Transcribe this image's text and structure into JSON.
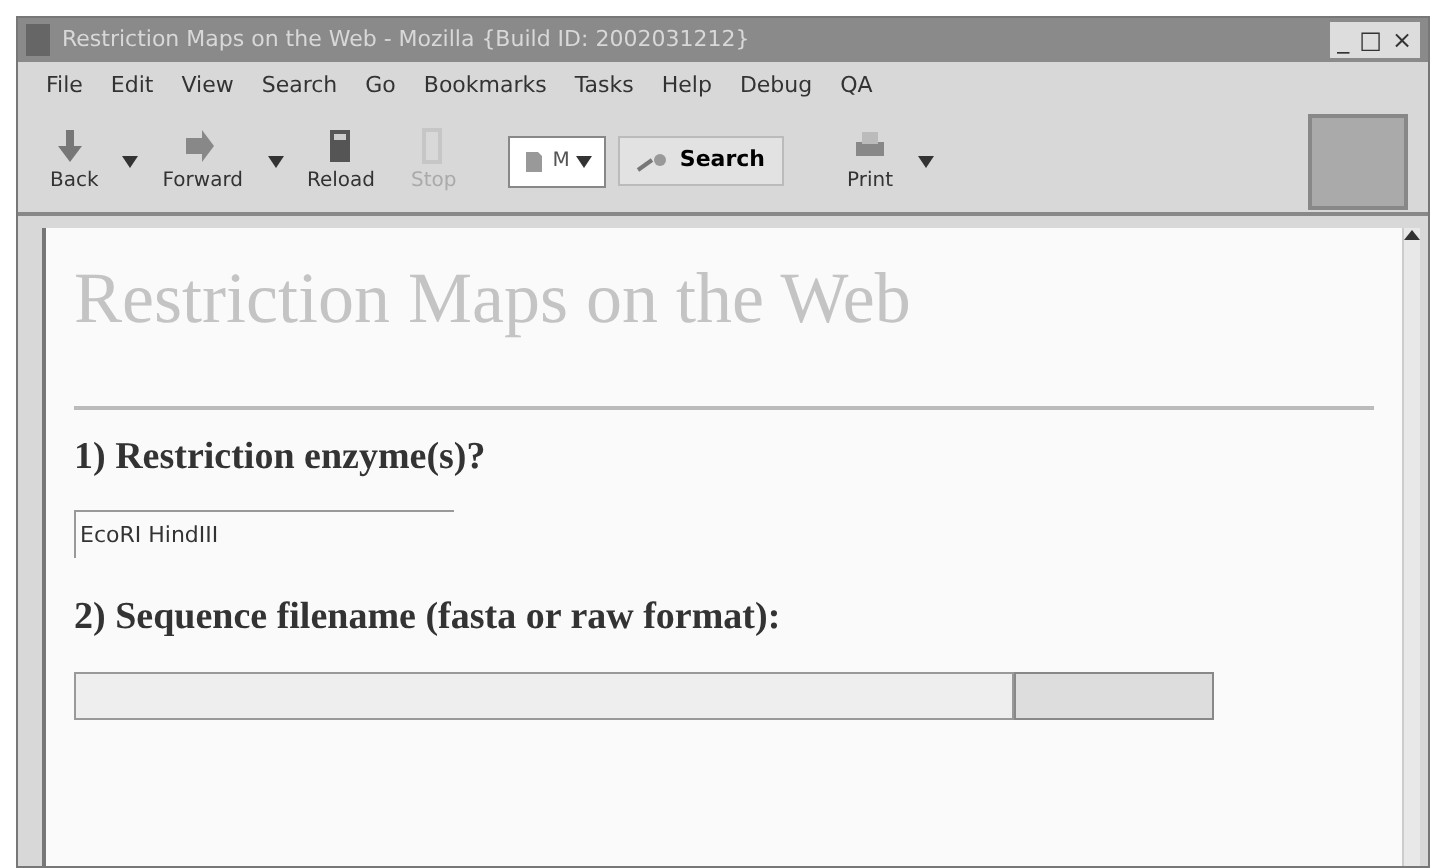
{
  "window": {
    "title": "Restriction Maps on the Web - Mozilla {Build ID: 2002031212}",
    "controls": [
      "_",
      "□",
      "×"
    ]
  },
  "menus": [
    "File",
    "Edit",
    "View",
    "Search",
    "Go",
    "Bookmarks",
    "Tasks",
    "Help",
    "Debug",
    "QA"
  ],
  "toolbar": [
    {
      "kind": "nav",
      "label": "Back",
      "dropdown": true,
      "disabled": false
    },
    {
      "kind": "nav",
      "label": "Forward",
      "dropdown": true,
      "disabled": false
    },
    {
      "kind": "nav",
      "label": "Reload",
      "dropdown": false,
      "disabled": false
    },
    {
      "kind": "nav",
      "label": "Stop",
      "dropdown": false,
      "disabled": true
    },
    {
      "kind": "url",
      "value": "M"
    },
    {
      "kind": "search",
      "label": "Search"
    },
    {
      "kind": "nav",
      "label": "Print",
      "dropdown": true,
      "disabled": false
    },
    {
      "kind": "throbber"
    }
  ],
  "page": {
    "heading": "Restriction Maps on the Web",
    "questions": [
      {
        "label": "1) Restriction enzyme(s)?",
        "kind": "text",
        "value": "EcoRI HindIII"
      },
      {
        "label": "2) Sequence filename (fasta or raw format):",
        "kind": "file"
      }
    ]
  }
}
